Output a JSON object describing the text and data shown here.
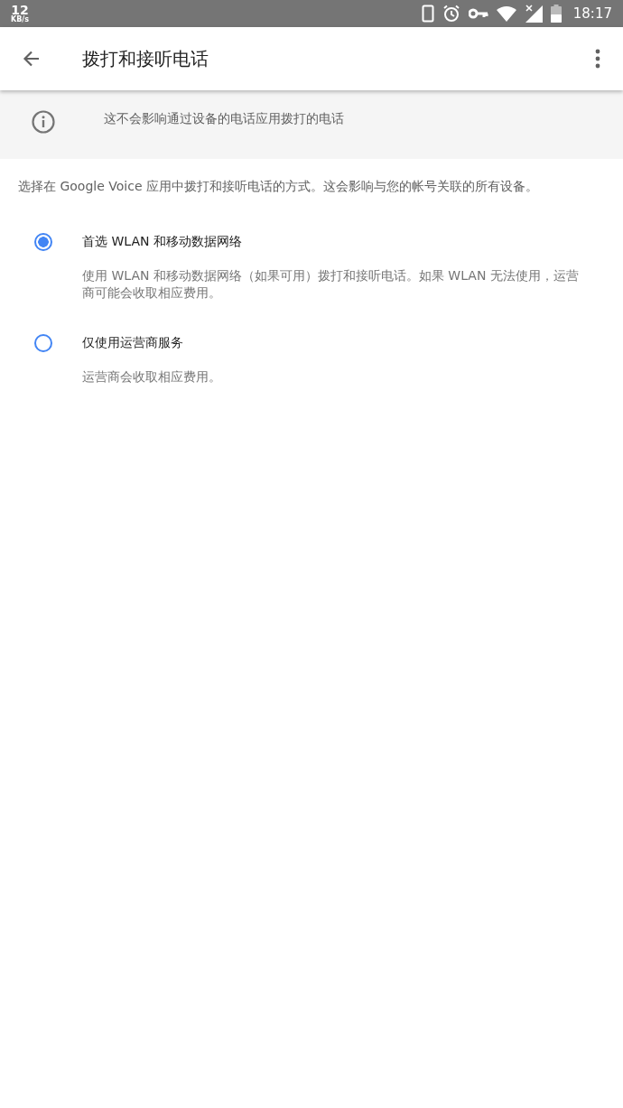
{
  "status_bar": {
    "speed": "12",
    "speed_unit": "KB/s",
    "time": "18:17"
  },
  "app_bar": {
    "title": "拨打和接听电话"
  },
  "notice": {
    "text": "这不会影响通过设备的电话应用拨打的电话"
  },
  "description": "选择在 Google Voice 应用中拨打和接听电话的方式。这会影响与您的帐号关联的所有设备。",
  "options": [
    {
      "label": "首选 WLAN 和移动数据网络",
      "detail": "使用 WLAN 和移动数据网络（如果可用）拨打和接听电话。如果 WLAN 无法使用，运营商可能会收取相应费用。",
      "selected": true
    },
    {
      "label": "仅使用运营商服务",
      "detail": "运营商会收取相应费用。",
      "selected": false
    }
  ]
}
